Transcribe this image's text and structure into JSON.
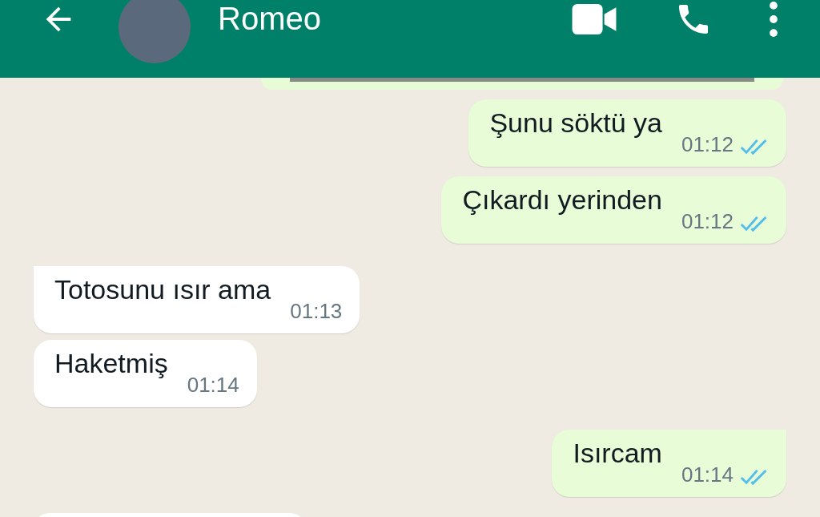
{
  "header": {
    "title": "Romeo"
  },
  "messages": [
    {
      "kind": "outgoing",
      "text": "Şunu söktü ya",
      "time": "01:12",
      "read": true,
      "tail": false
    },
    {
      "kind": "outgoing",
      "text": "Çıkardı yerinden",
      "time": "01:12",
      "read": true,
      "tail": false
    },
    {
      "kind": "incoming",
      "text": "Totosunu ısır ama",
      "time": "01:13",
      "tail": true
    },
    {
      "kind": "incoming",
      "text": "Haketmiş",
      "time": "01:14",
      "tail": false
    },
    {
      "kind": "outgoing",
      "text": "Isırcam",
      "time": "01:14",
      "read": true,
      "tail": true
    }
  ]
}
